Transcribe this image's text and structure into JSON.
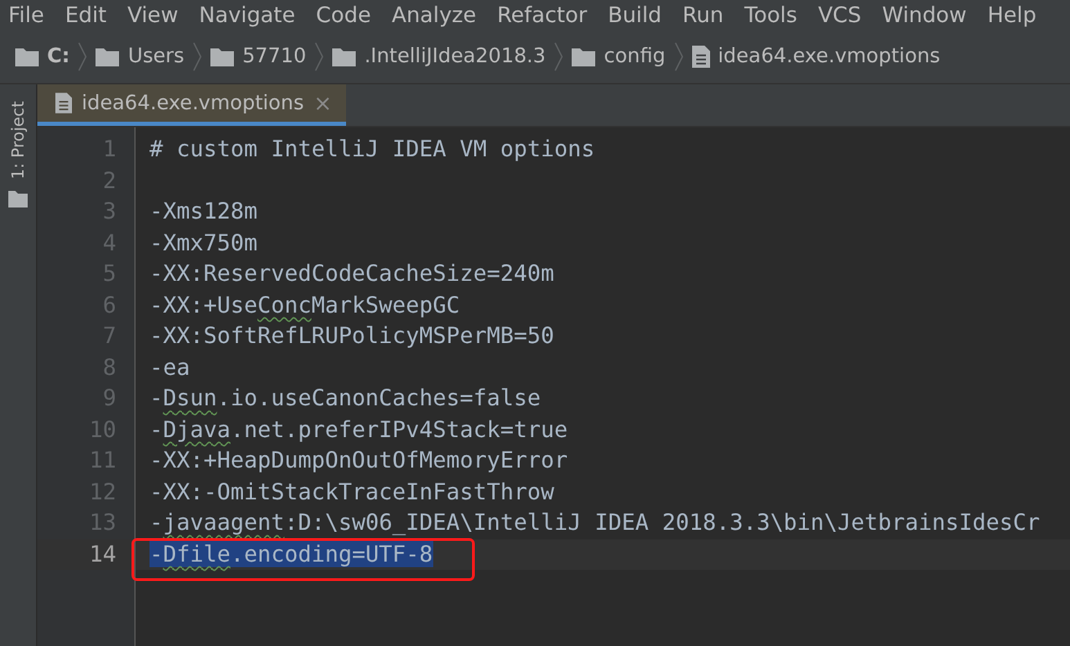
{
  "menu": [
    "File",
    "Edit",
    "View",
    "Navigate",
    "Code",
    "Analyze",
    "Refactor",
    "Build",
    "Run",
    "Tools",
    "VCS",
    "Window",
    "Help"
  ],
  "breadcrumb": [
    {
      "kind": "folder",
      "label": "C:"
    },
    {
      "kind": "folder",
      "label": "Users"
    },
    {
      "kind": "folder",
      "label": "57710"
    },
    {
      "kind": "folder",
      "label": ".IntelliJIdea2018.3"
    },
    {
      "kind": "folder",
      "label": "config"
    },
    {
      "kind": "file",
      "label": "idea64.exe.vmoptions"
    }
  ],
  "side_tool": {
    "label": "1: Project"
  },
  "tabs": [
    {
      "label": "idea64.exe.vmoptions",
      "close": "×",
      "selected": true
    }
  ],
  "lines": [
    {
      "number": "1",
      "selected": false,
      "segments": [
        {
          "text": "# custom IntelliJ IDEA VM options",
          "typo": false
        }
      ]
    },
    {
      "number": "2",
      "selected": false
    },
    {
      "number": "3",
      "selected": false,
      "segments": [
        {
          "text": "-Xms128m",
          "typo": false
        }
      ]
    },
    {
      "number": "4",
      "selected": false,
      "segments": [
        {
          "text": "-Xmx750m",
          "typo": false
        }
      ]
    },
    {
      "number": "5",
      "selected": false,
      "segments": [
        {
          "text": "-XX:ReservedCodeCacheSize=240m",
          "typo": false
        }
      ]
    },
    {
      "number": "6",
      "selected": false,
      "segments": [
        {
          "text": "-XX:+Use",
          "typo": false
        },
        {
          "text": "Conc",
          "typo": true
        },
        {
          "text": "MarkSweepGC",
          "typo": false
        }
      ]
    },
    {
      "number": "7",
      "selected": false,
      "segments": [
        {
          "text": "-XX:SoftRefLRUPolicyMSPerMB=50",
          "typo": false
        }
      ]
    },
    {
      "number": "8",
      "selected": false,
      "segments": [
        {
          "text": "-ea",
          "typo": false
        }
      ]
    },
    {
      "number": "9",
      "selected": false,
      "segments": [
        {
          "text": "-",
          "typo": false
        },
        {
          "text": "Dsun",
          "typo": true
        },
        {
          "text": ".io.useCanonCaches=false",
          "typo": false
        }
      ]
    },
    {
      "number": "10",
      "selected": false,
      "segments": [
        {
          "text": "-",
          "typo": false
        },
        {
          "text": "Djava",
          "typo": true
        },
        {
          "text": ".net.preferIPv4Stack=true",
          "typo": false
        }
      ]
    },
    {
      "number": "11",
      "selected": false,
      "segments": [
        {
          "text": "-XX:+HeapDumpOnOutOfMemoryError",
          "typo": false
        }
      ]
    },
    {
      "number": "12",
      "selected": false,
      "segments": [
        {
          "text": "-XX:-OmitStackTraceInFastThrow",
          "typo": false
        }
      ]
    },
    {
      "number": "13",
      "selected": false,
      "segments": [
        {
          "text": "-",
          "typo": false
        },
        {
          "text": "javaagent",
          "typo": true
        },
        {
          "text": ":D:\\sw06_IDEA\\IntelliJ IDEA 2018.3.3\\bin\\JetbrainsIdesCr",
          "typo": false
        }
      ]
    },
    {
      "number": "14",
      "selected": true,
      "segments": [
        {
          "text": "-",
          "typo": false
        },
        {
          "text": "Dfile",
          "typo": true
        },
        {
          "text": ".encoding=UTF-8",
          "typo": false
        }
      ]
    }
  ]
}
